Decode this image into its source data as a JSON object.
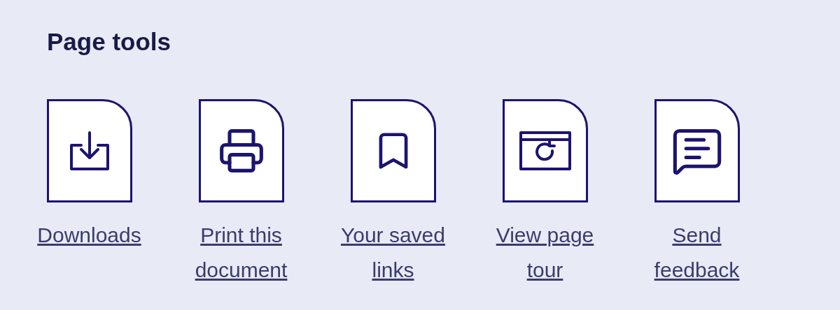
{
  "title": "Page tools",
  "tools": [
    {
      "kind": "download",
      "label": "Downloads"
    },
    {
      "kind": "print",
      "label": "Print this document"
    },
    {
      "kind": "bookmark",
      "label": "Your saved links"
    },
    {
      "kind": "tour",
      "label": "View page tour"
    },
    {
      "kind": "feedback",
      "label": "Send feedback"
    }
  ]
}
